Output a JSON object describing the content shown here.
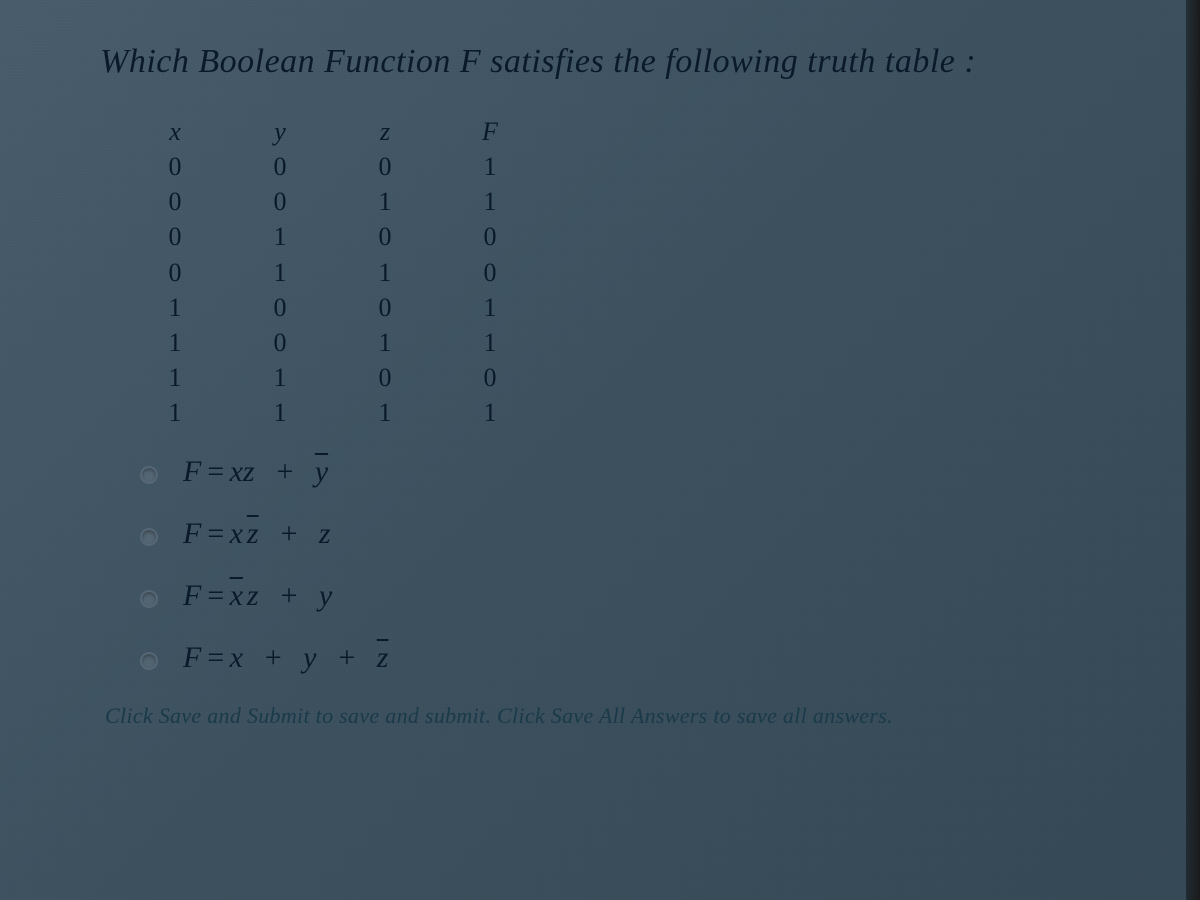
{
  "question_title": "Which Boolean Function F satisfies the following truth table :",
  "truth_table": {
    "headers": [
      "x",
      "y",
      "z",
      "F"
    ],
    "rows": [
      [
        "0",
        "0",
        "0",
        "1"
      ],
      [
        "0",
        "0",
        "1",
        "1"
      ],
      [
        "0",
        "1",
        "0",
        "0"
      ],
      [
        "0",
        "1",
        "1",
        "0"
      ],
      [
        "1",
        "0",
        "0",
        "1"
      ],
      [
        "1",
        "0",
        "1",
        "1"
      ],
      [
        "1",
        "1",
        "0",
        "0"
      ],
      [
        "1",
        "1",
        "1",
        "1"
      ]
    ]
  },
  "options": {
    "a": {
      "lhs": "F",
      "eq": "=",
      "t1a": "xz",
      "plus1": "+",
      "t2a": "y",
      "t2a_bar": true
    },
    "b": {
      "lhs": "F",
      "eq": "=",
      "t1a": "x",
      "t1b": "z",
      "t1b_bar": true,
      "plus1": "+",
      "t2a": "z"
    },
    "c": {
      "lhs": "F",
      "eq": "=",
      "t1a": "x",
      "t1a_bar": true,
      "t1b": "z",
      "plus1": "+",
      "t2a": "y"
    },
    "d": {
      "lhs": "F",
      "eq": "=",
      "t1a": "x",
      "plus1": "+",
      "t2a": "y",
      "plus2": "+",
      "t3a": "z",
      "t3a_bar": true
    }
  },
  "hint": "Click Save and Submit to save and submit. Click Save All Answers to save all answers."
}
